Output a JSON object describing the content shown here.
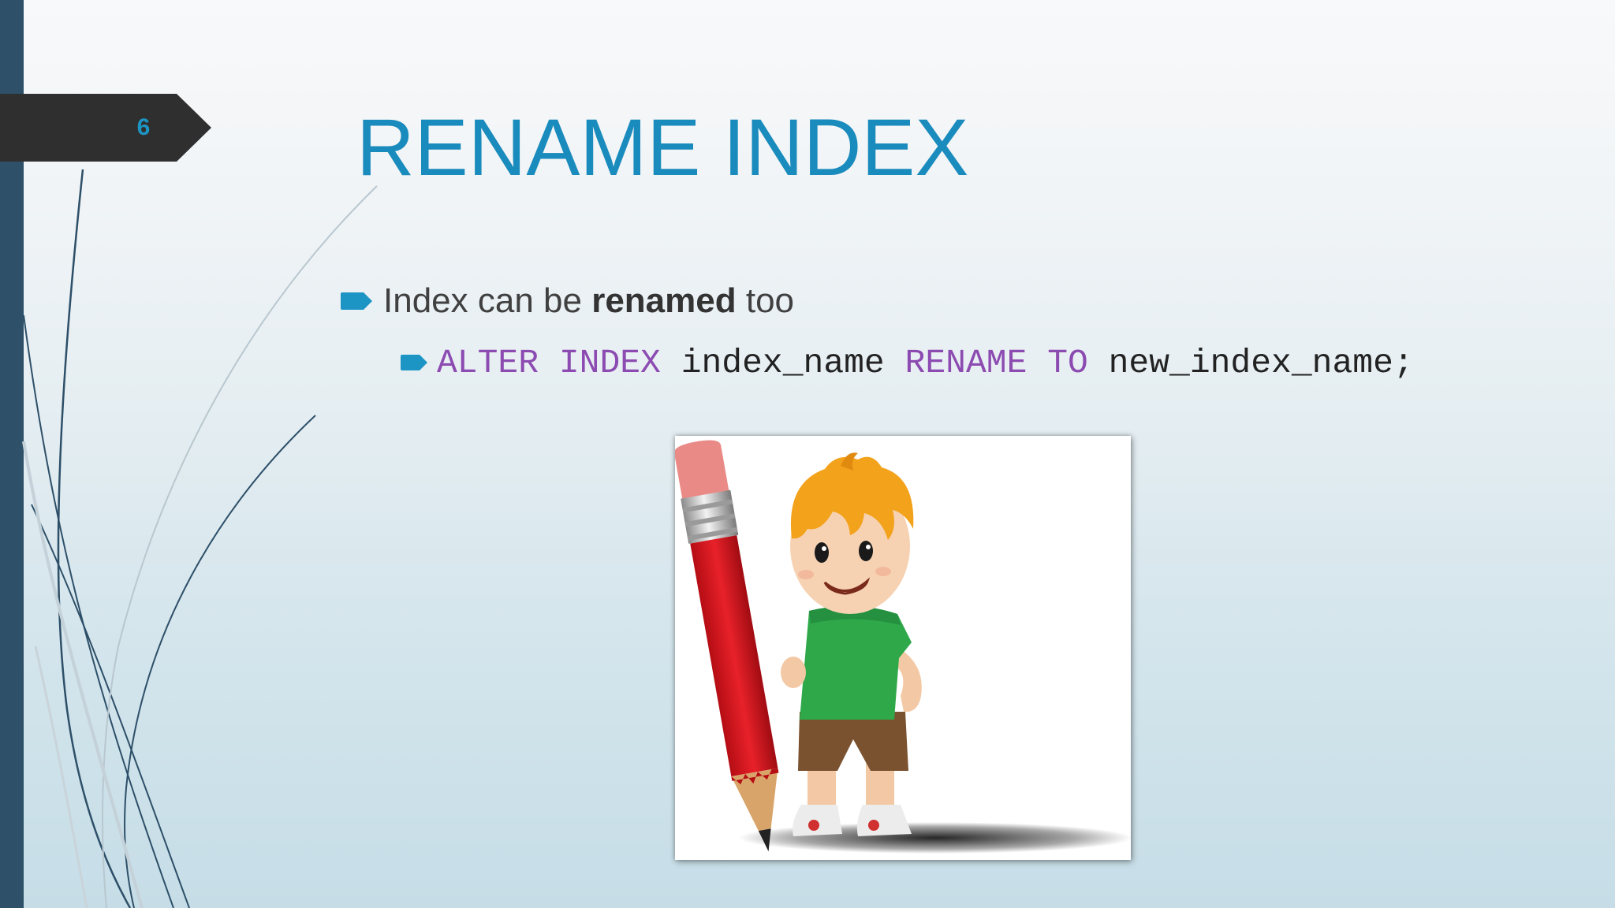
{
  "slide": {
    "number": "6",
    "title": "RENAME INDEX",
    "bullets": [
      {
        "text_before": "Index can be ",
        "text_bold": "renamed",
        "text_after": " too"
      }
    ],
    "code_line": {
      "kw1": "ALTER",
      "kw2": "INDEX",
      "ident1": "index_name",
      "kw3": "RENAME",
      "kw4": "TO",
      "ident2": "new_index_name;"
    },
    "image": {
      "icon": "boy-with-pencil-illustration"
    }
  },
  "colors": {
    "accent": "#1a8bbd",
    "keyword": "#8c4bb1",
    "sidebar": "#2e5068",
    "tab": "#2f2f2f"
  }
}
